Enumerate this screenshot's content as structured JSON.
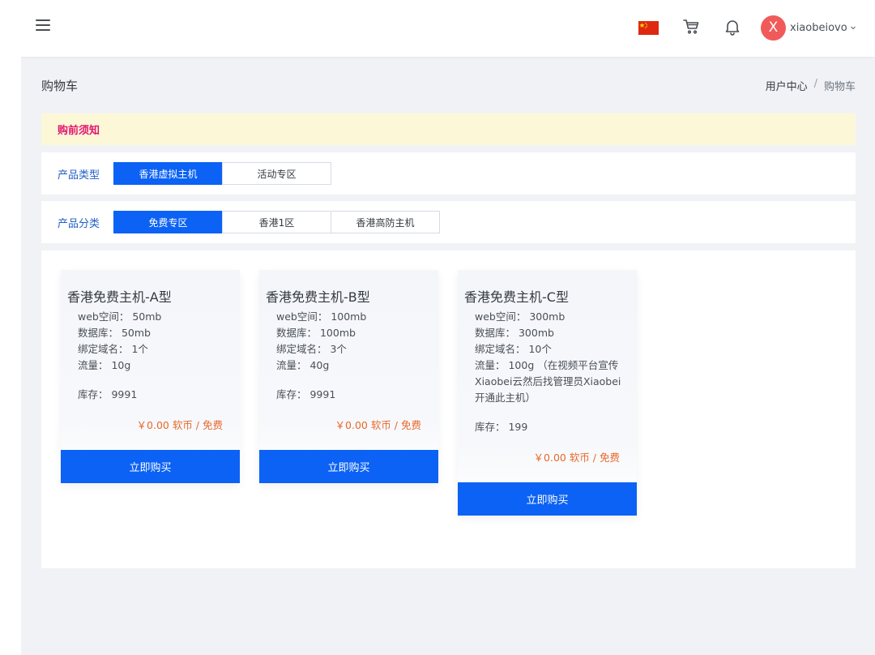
{
  "header": {
    "username": "xiaobeiovo",
    "avatar_letter": "X",
    "flag": "china-flag",
    "icons": [
      "menu-icon",
      "cart-icon",
      "bell-icon",
      "chevron-down-icon"
    ]
  },
  "page": {
    "title": "购物车",
    "breadcrumb": [
      "用户中心",
      "购物车"
    ],
    "breadcrumb_separator": "/"
  },
  "notice": {
    "text": "购前须知"
  },
  "filters": {
    "type": {
      "label": "产品类型",
      "options": [
        "香港虚拟主机",
        "活动专区"
      ],
      "selected": "香港虚拟主机"
    },
    "category": {
      "label": "产品分类",
      "options": [
        "免费专区",
        "香港1区",
        "香港高防主机"
      ],
      "selected": "免费专区"
    }
  },
  "products": [
    {
      "name": "香港免费主机-A型",
      "specs": [
        "web空间： 50mb",
        "数据库： 50mb",
        "绑定域名： 1个",
        "流量： 10g"
      ],
      "stock": "库存： 9991",
      "price": "￥0.00 软币 / 免费",
      "button": "立即购买"
    },
    {
      "name": "香港免费主机-B型",
      "specs": [
        "web空间： 100mb",
        "数据库： 100mb",
        "绑定域名： 3个",
        "流量： 40g"
      ],
      "stock": "库存： 9991",
      "price": "￥0.00 软币 / 免费",
      "button": "立即购买"
    },
    {
      "name": "香港免费主机-C型",
      "specs": [
        "web空间： 300mb",
        "数据库： 300mb",
        "绑定域名： 10个",
        "流量： 100g （在视频平台宣传Xiaobei云然后找管理员Xiaobei开通此主机）"
      ],
      "stock": "库存： 199",
      "price": "￥0.00 软币 / 免费",
      "button": "立即购买"
    }
  ],
  "colors": {
    "primary": "#0b62f5",
    "price": "#e8692d",
    "notice_bg": "#fcf8d7",
    "notice_text": "#e4156f",
    "avatar": "#f15a5a"
  }
}
